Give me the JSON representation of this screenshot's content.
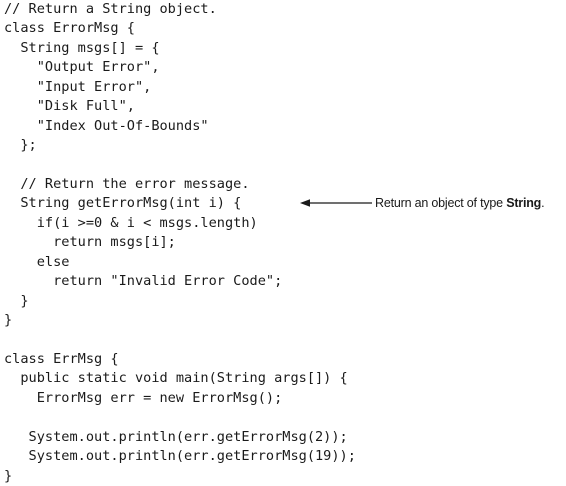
{
  "code": {
    "lines": [
      "// Return a String object.",
      "class ErrorMsg {",
      "  String msgs[] = {",
      "    \"Output Error\",",
      "    \"Input Error\",",
      "    \"Disk Full\",",
      "    \"Index Out-Of-Bounds\"",
      "  };",
      "",
      "  // Return the error message.",
      "  String getErrorMsg(int i) {",
      "    if(i >=0 & i < msgs.length)",
      "      return msgs[i];",
      "    else",
      "      return \"Invalid Error Code\";",
      "  }",
      "}",
      "",
      "class ErrMsg {",
      "  public static void main(String args[]) {",
      "    ErrorMsg err = new ErrorMsg();",
      "",
      "   System.out.println(err.getErrorMsg(2));",
      "   System.out.println(err.getErrorMsg(19));",
      "}"
    ]
  },
  "annotation": {
    "prefix": "Return an object of type ",
    "emphasis": "String",
    "suffix": "."
  }
}
